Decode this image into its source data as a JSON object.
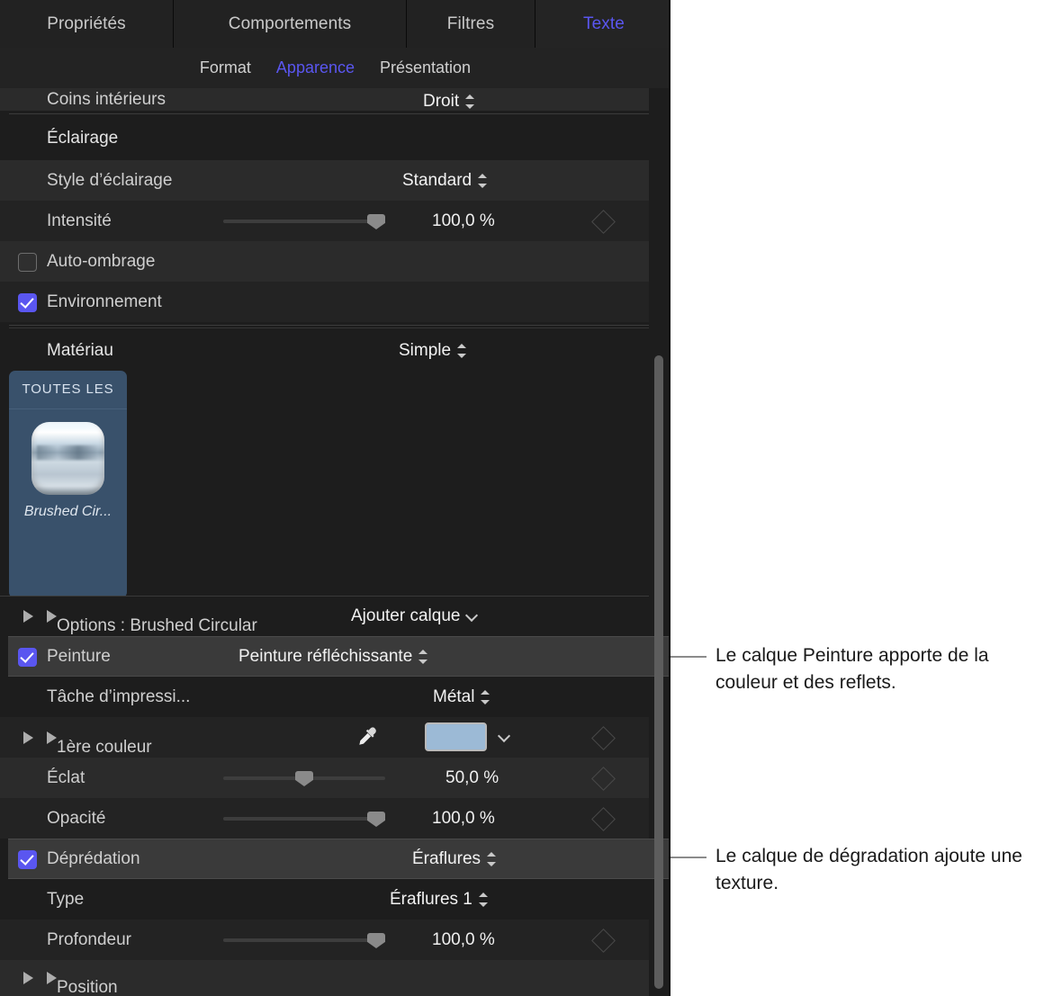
{
  "tabs": [
    {
      "label": "Propriétés",
      "active": false
    },
    {
      "label": "Comportements",
      "active": false
    },
    {
      "label": "Filtres",
      "active": false
    },
    {
      "label": "Texte",
      "active": true
    }
  ],
  "subtabs": [
    {
      "label": "Format",
      "active": false
    },
    {
      "label": "Apparence",
      "active": true
    },
    {
      "label": "Présentation",
      "active": false
    }
  ],
  "rows": {
    "inner_corners": {
      "label": "Coins intérieurs",
      "value": "Droit"
    },
    "lighting_header": "Éclairage",
    "lighting_style": {
      "label": "Style d’éclairage",
      "value": "Standard"
    },
    "intensity": {
      "label": "Intensité",
      "value": "100,0 %",
      "slider_percent": 100
    },
    "auto_shadow": {
      "label": "Auto-ombrage",
      "checked": false
    },
    "environment": {
      "label": "Environnement",
      "checked": true
    },
    "material": {
      "label": "Matériau",
      "value": "Simple"
    },
    "options": {
      "label": "Options : Brushed Circular",
      "action": "Ajouter calque"
    },
    "paint": {
      "label": "Peinture",
      "value": "Peinture réfléchissante",
      "checked": true
    },
    "print_task": {
      "label": "Tâche d’impressi...",
      "value": "Métal"
    },
    "first_color": {
      "label": "1ère couleur",
      "swatch_color": "#9cbad6"
    },
    "shine": {
      "label": "Éclat",
      "value": "50,0 %",
      "slider_percent": 50
    },
    "opacity": {
      "label": "Opacité",
      "value": "100,0 %",
      "slider_percent": 100
    },
    "degradation": {
      "label": "Déprédation",
      "value": "Éraflures",
      "checked": true
    },
    "type": {
      "label": "Type",
      "value": "Éraflures 1"
    },
    "depth": {
      "label": "Profondeur",
      "value": "100,0 %",
      "slider_percent": 100
    },
    "position": {
      "label": "Position"
    }
  },
  "browser": {
    "category": "TOUTES LES",
    "item_name": "Brushed Cir...",
    "selected_color": "#39516b"
  },
  "notes": [
    {
      "text": "Le calque Peinture apporte de la couleur et des reflets."
    },
    {
      "text": "Le calque de dégradation ajoute une texture."
    }
  ],
  "colors": {
    "accent": "#5a56f0",
    "panel_bg": "#1d1d1d",
    "row_light": "#2b2b2b",
    "row_dark": "#232323",
    "text": "#cfcfcf",
    "swatch": "#9cbad6",
    "scrollbar": "#5d5d5d"
  },
  "icons": {
    "eyedropper": "eyedropper-icon",
    "keyframe": "keyframe-diamond-icon",
    "disclosure": "disclosure-triangle-icon",
    "updown": "updown-chevrons-icon",
    "chevron_down": "chevron-down-icon"
  }
}
